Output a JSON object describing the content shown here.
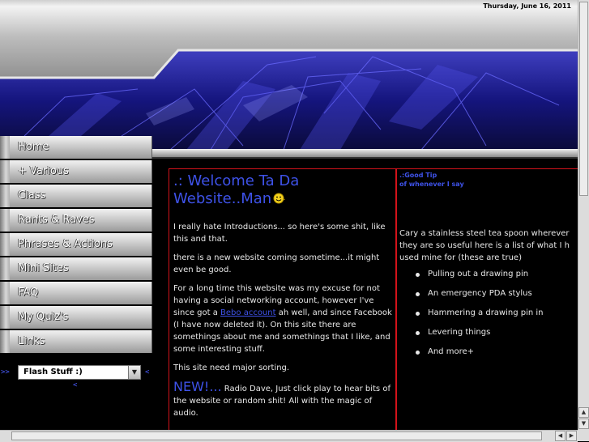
{
  "header": {
    "date": "Thursday, June 16, 2011"
  },
  "nav": {
    "items": [
      {
        "label": "Home"
      },
      {
        "label": "+ Various"
      },
      {
        "label": "Class"
      },
      {
        "label": "Rants & Raves"
      },
      {
        "label": "Phrases & Actions"
      },
      {
        "label": "Mini Sites"
      },
      {
        "label": "FAQ"
      },
      {
        "label": "My Quiz's"
      },
      {
        "label": "Links"
      }
    ],
    "flash": {
      "left_arrow": ">>",
      "selected": "Flash Stuff :)",
      "right_arrow": "<",
      "below_arrow": "<"
    }
  },
  "main": {
    "title": ".: Welcome Ta Da Website..Man",
    "p1": "I really hate Introductions... so here's some shit, like this and that.",
    "p2": "there is a new website coming sometime...it might even be good.",
    "p3_before": "For a long time this website was my excuse for not having a social networking account, however I've since got a ",
    "p3_link": "Bebo account",
    "p3_after": " ah well, and since Facebook (I have now deleted it). On this site there are somethings about me and somethings that I like, and some interesting stuff.",
    "p4": "This site need major sorting.",
    "new_label": "NEW!...",
    "p5": " Radio Dave, Just click play to hear bits of the website or random shit! All with the magic of audio."
  },
  "tip": {
    "title_line1": ".:Good Tip",
    "title_line2": "of whenever I say",
    "intro_line1": "Cary a stainless steel tea spoon wherever",
    "intro_line2": "they are so useful here is a list of what I h",
    "intro_line3": "used mine for (these are true)",
    "items": [
      "Pulling out a drawing pin",
      "An emergency PDA stylus",
      "Hammering a drawing pin in",
      "Levering things",
      "And more+"
    ]
  },
  "colors": {
    "link_blue": "#3e52e8",
    "border_red": "#d2121a",
    "header_blue": "#1a1aa0"
  }
}
